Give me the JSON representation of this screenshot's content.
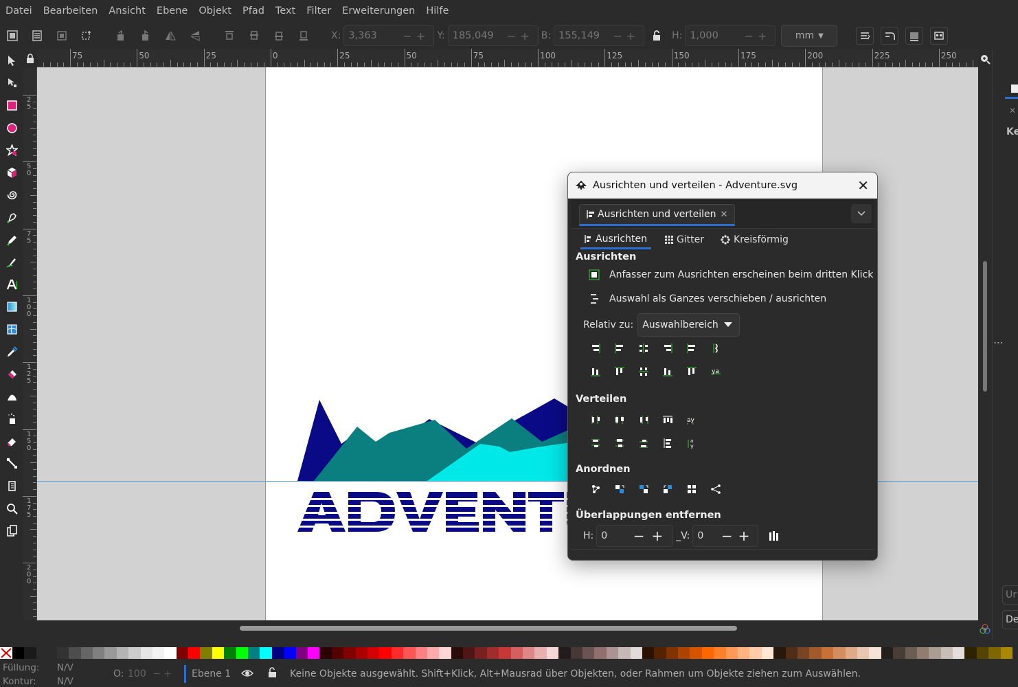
{
  "menubar": {
    "items": [
      "Datei",
      "Bearbeiten",
      "Ansicht",
      "Ebene",
      "Objekt",
      "Pfad",
      "Text",
      "Filter",
      "Erweiterungen",
      "Hilfe"
    ]
  },
  "toolbar": {
    "x_label": "X:",
    "x_value": "3,363",
    "y_label": "Y:",
    "y_value": "185,049",
    "w_label": "B:",
    "w_value": "155,149",
    "h_label": "H:",
    "h_value": "1,000",
    "unit": "mm"
  },
  "hruler": {
    "labels": [
      "75",
      "50",
      "25",
      "0",
      "25",
      "50",
      "75",
      "100",
      "125",
      "150",
      "175",
      "200",
      "225",
      "250"
    ]
  },
  "vruler": {
    "labels": [
      "2\n5",
      "5\n0",
      "7\n5",
      "1\n0\n0",
      "1\n2\n5",
      "1\n5\n0",
      "1\n7\n5",
      "2\n0\n0"
    ]
  },
  "canvas": {
    "artwork_text": "ADVENTU",
    "colors": {
      "navy": "#0a0a87",
      "teal": "#0b7f7f",
      "cyan": "#00e8e8",
      "guide": "#5aa0d8"
    }
  },
  "dialog": {
    "title": "Ausrichten und verteilen - Adventure.svg",
    "doc_tab": "Ausrichten und verteilen",
    "tabs": [
      "Ausrichten",
      "Gitter",
      "Kreisförmig"
    ],
    "align_section": "Ausrichten",
    "opt1": "Anfasser zum Ausrichten erscheinen beim dritten Klick",
    "opt2": "Auswahl als Ganzes verschieben / ausrichten",
    "relative_label": "Relativ zu:",
    "relative_value": "Auswahlbereich",
    "distribute_section": "Verteilen",
    "arrange_section": "Anordnen",
    "overlap_section": "Überlappungen entfernen",
    "h_label": "H:",
    "h_value": "0",
    "v_label": "_V:",
    "v_value": "0"
  },
  "rightpanel": {
    "top_text": "Ke",
    "btn1": "Ur",
    "btn2": "De"
  },
  "status": {
    "fill_label": "Füllung:",
    "fill_value": "N/V",
    "stroke_label": "Kontur:",
    "stroke_value": "N/V",
    "opacity_label": "O:",
    "opacity_value": "100",
    "layer": "Ebene 1",
    "message": "Keine Objekte ausgewählt. Shift+Klick, Alt+Mausrad über Objekten, oder Rahmen um Objekte ziehen zum Auswählen."
  },
  "palette": {
    "colors": [
      "#000000",
      "#1a1a1a",
      "#333333",
      "#4d4d4d",
      "#666666",
      "#808080",
      "#999999",
      "#b3b3b3",
      "#cccccc",
      "#e6e6e6",
      "#f2f2f2",
      "#ffffff",
      "#800000",
      "#ff0000",
      "#808000",
      "#ffff00",
      "#008000",
      "#00ff00",
      "#008080",
      "#00ffff",
      "#000080",
      "#0000ff",
      "#800080",
      "#ff00ff",
      "#2b0000",
      "#550000",
      "#800000",
      "#aa0000",
      "#d40000",
      "#ff0000",
      "#ff2a2a",
      "#ff5555",
      "#ff8080",
      "#ffaaaa",
      "#ffd5d5",
      "#280b0b",
      "#501616",
      "#782121",
      "#a02c2c",
      "#c83737",
      "#d35f5f",
      "#de8787",
      "#e9afaf",
      "#f4d7d7",
      "#241c1c",
      "#483737",
      "#6c5353",
      "#916f6f",
      "#ac9393",
      "#c8b7b7",
      "#e3dbdb",
      "#2b1100",
      "#552200",
      "#803300",
      "#aa4400",
      "#d45500",
      "#ff6600",
      "#ff7f2a",
      "#ff9955",
      "#ffb380",
      "#ffccaa",
      "#ffe6d5",
      "#28170b",
      "#502d16",
      "#784421",
      "#a05a2c",
      "#c87137",
      "#d38d5f",
      "#deaa87",
      "#e9c6af",
      "#f4e3d7",
      "#241f1c",
      "#483e37",
      "#6c5d53",
      "#917c6f",
      "#ac9d93",
      "#c8beb7",
      "#e3dedb",
      "#2b2200",
      "#554400",
      "#806600",
      "#aa8800"
    ]
  }
}
